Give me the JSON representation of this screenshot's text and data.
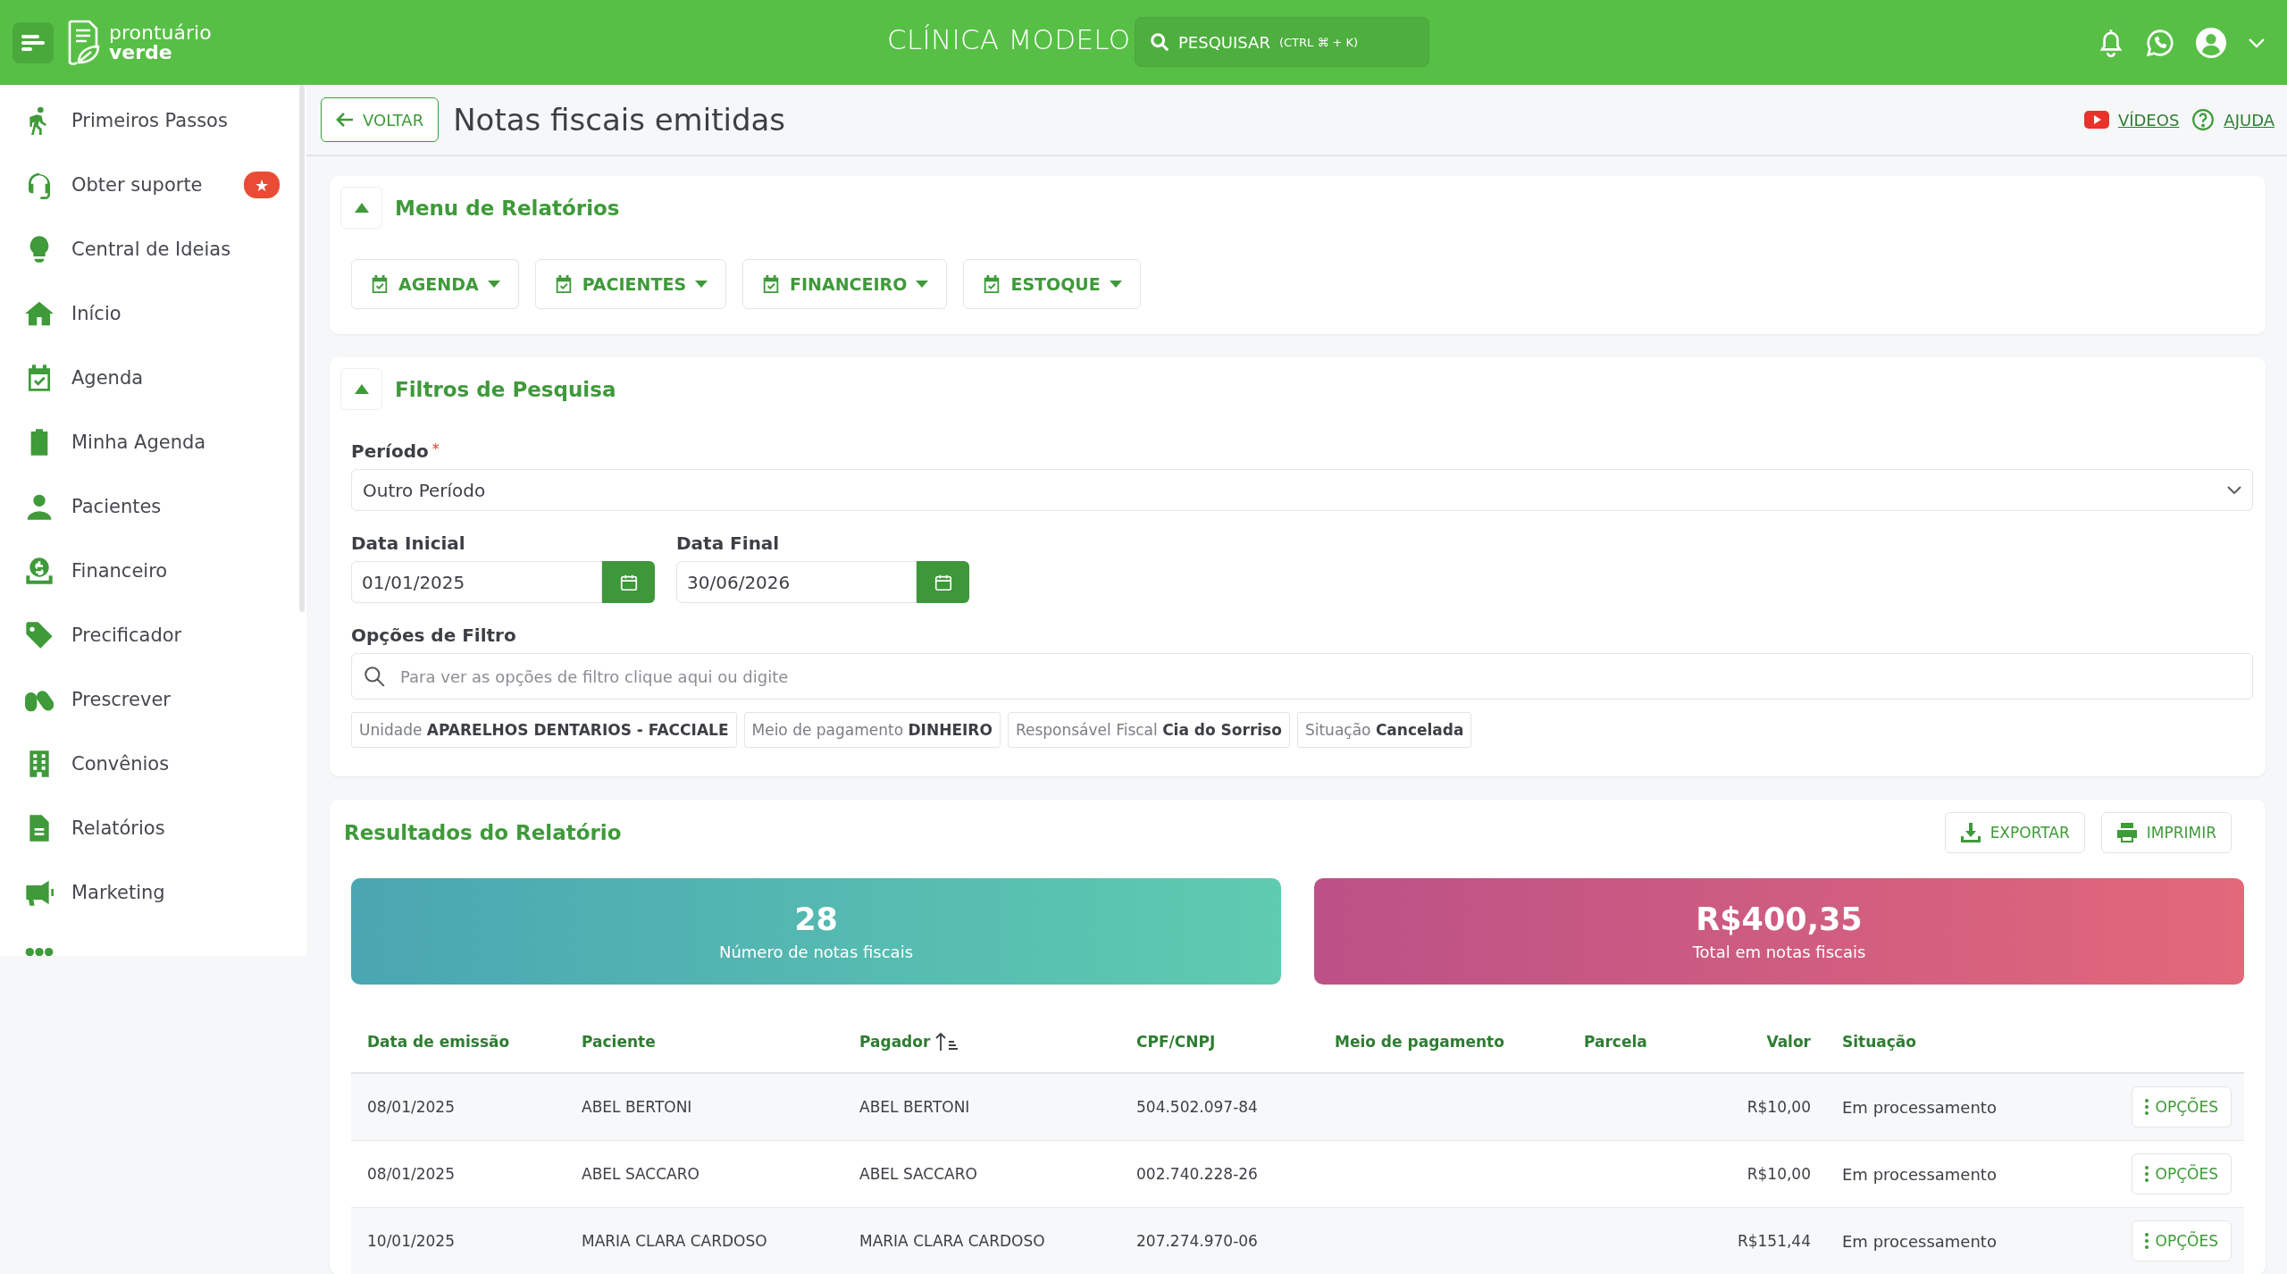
{
  "header": {
    "brand": {
      "line_1": "prontuário",
      "line_2": "verde"
    },
    "clinic": "CLÍNICA MODELO",
    "search": {
      "label": "PESQUISAR",
      "shortcut": "(CTRL ⌘ + K)"
    }
  },
  "sidebar": {
    "items": [
      {
        "label": "Primeiros Passos"
      },
      {
        "label": "Obter suporte",
        "badge": "★"
      },
      {
        "label": "Central de Ideias"
      },
      {
        "label": "Início"
      },
      {
        "label": "Agenda"
      },
      {
        "label": "Minha Agenda"
      },
      {
        "label": "Pacientes"
      },
      {
        "label": "Financeiro"
      },
      {
        "label": "Precificador"
      },
      {
        "label": "Prescrever"
      },
      {
        "label": "Convênios"
      },
      {
        "label": "Relatórios"
      },
      {
        "label": "Marketing"
      }
    ]
  },
  "page": {
    "back": "VOLTAR",
    "title": "Notas fiscais emitidas",
    "links": [
      "VÍDEOS",
      "AJUDA"
    ]
  },
  "report_menu": {
    "title": "Menu de Relatórios",
    "expanded": true,
    "buttons": [
      "AGENDA",
      "PACIENTES",
      "FINANCEIRO",
      "ESTOQUE"
    ]
  },
  "filters": {
    "title": "Filtros de Pesquisa",
    "expanded": true,
    "period": {
      "label": "Período",
      "required_mark": "*",
      "value": "Outro Período"
    },
    "start_date": {
      "label": "Data Inicial",
      "value": "01/01/2025"
    },
    "end_date": {
      "label": "Data Final",
      "value": "30/06/2026"
    },
    "filter_options": {
      "label": "Opções de Filtro",
      "placeholder": "Para ver as opções de filtro clique aqui ou digite"
    },
    "chips": [
      "Unidade **APARELHOS DENTARIOS - FACCIALE**",
      "Meio de pagamento **DINHEIRO**",
      "Responsável Fiscal **Cia do Sorriso**",
      "Situação **Cancelada**"
    ]
  },
  "results": {
    "title": "Resultados do Relatório",
    "actions": [
      "EXPORTAR",
      "IMPRIMIR"
    ],
    "stats": [
      {
        "kind": "count",
        "value": "28",
        "label": "Número de notas fiscais"
      },
      {
        "kind": "total",
        "value": "R$400,35",
        "label": "Total em notas fiscais"
      }
    ],
    "table": {
      "columns": [
        {
          "label": "Data de emissão",
          "sorted": false
        },
        {
          "label": "Paciente",
          "sorted": false
        },
        {
          "label": "Pagador",
          "sorted": true
        },
        {
          "label": "CPF/CNPJ",
          "sorted": false
        },
        {
          "label": "Meio de pagamento",
          "sorted": false
        },
        {
          "label": "Parcela",
          "sorted": false
        },
        {
          "label": "Valor",
          "sorted": false
        },
        {
          "label": "Situação",
          "sorted": false
        }
      ],
      "rows": [
        {
          "date": "08/01/2025",
          "patient": "ABEL BERTONI",
          "payer": "ABEL BERTONI",
          "document": "504.502.097-84",
          "value": "R$10,00",
          "status": "Em processamento",
          "action": "OPÇÕES"
        },
        {
          "date": "08/01/2025",
          "patient": "ABEL SACCARO",
          "payer": "ABEL SACCARO",
          "document": "002.740.228-26",
          "value": "R$10,00",
          "status": "Em processamento",
          "action": "OPÇÕES"
        },
        {
          "date": "10/01/2025",
          "patient": "MARIA CLARA CARDOSO",
          "payer": "MARIA CLARA CARDOSO",
          "document": "207.274.970-06",
          "value": "R$151,44",
          "status": "Em processamento",
          "action": "OPÇÕES"
        }
      ]
    }
  }
}
